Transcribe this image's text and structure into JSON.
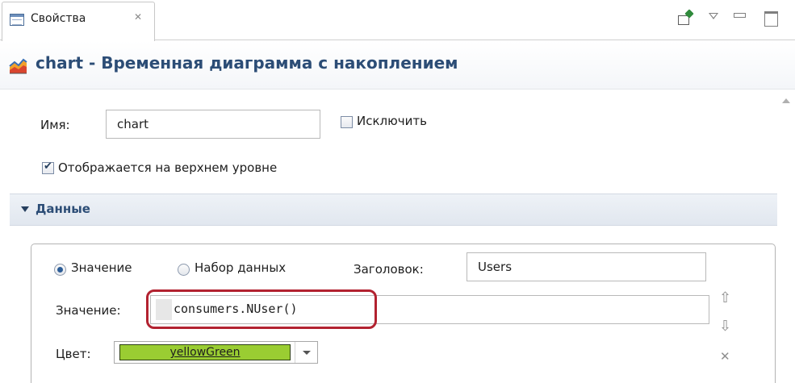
{
  "tab": {
    "label": "Свойства",
    "icon": "properties-icon",
    "close_icon": "close-icon"
  },
  "toolbar": {
    "pin_icon": "pin-icon",
    "menu_icon": "view-menu-icon",
    "minimize_icon": "minimize-icon",
    "maximize_icon": "maximize-icon"
  },
  "header": {
    "icon": "stack-chart-icon",
    "title": "chart - Временная диаграмма с накоплением"
  },
  "general": {
    "name_label": "Имя:",
    "name_value": "chart",
    "exclude_label": "Исключить",
    "exclude_checked": false,
    "toplevel_label": "Отображается на верхнем уровне",
    "toplevel_checked": true
  },
  "section": {
    "label": "Данные",
    "expanded": true
  },
  "data_item": {
    "mode_value_label": "Значение",
    "mode_dataset_label": "Набор данных",
    "selected_mode": "value",
    "title_label": "Заголовок:",
    "title_value": "Users",
    "value_label": "Значение:",
    "value_expression": "consumers.NUser()",
    "color_label": "Цвет:",
    "color_name": "yellowGreen",
    "color_hex": "#9acd32",
    "highlight_color": "#b22230"
  },
  "side_buttons": {
    "move_up_icon": "arrow-up-icon",
    "move_down_icon": "arrow-down-icon",
    "remove_icon": "remove-icon"
  },
  "colors": {
    "header_title": "#2c4d76",
    "section_bg": "#e6ebf2"
  }
}
